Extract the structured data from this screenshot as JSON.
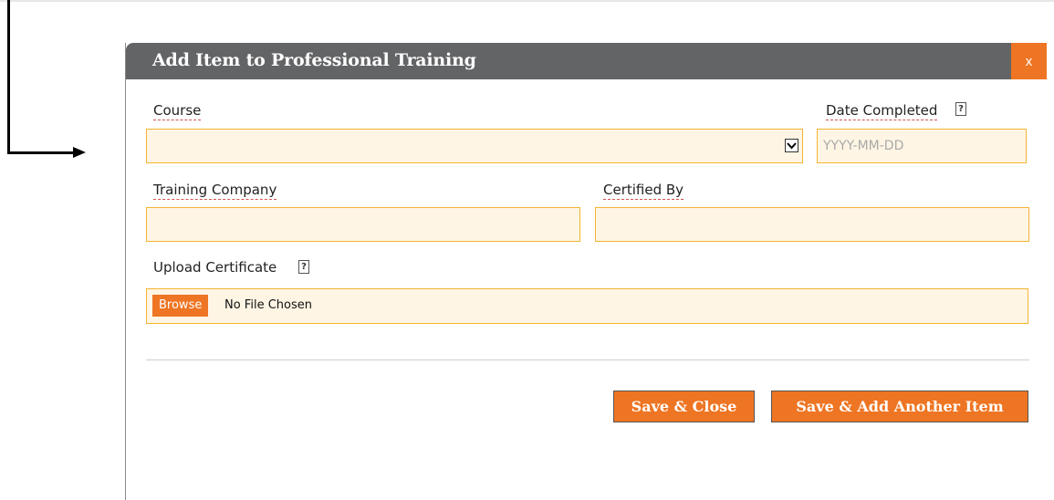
{
  "dialog": {
    "title": "Add Item to Professional Training",
    "close_label": "x"
  },
  "fields": {
    "course": {
      "label": "Course",
      "value": ""
    },
    "date_completed": {
      "label": "Date Completed",
      "placeholder": "YYYY-MM-DD",
      "value": ""
    },
    "training_company": {
      "label": "Training Company",
      "value": ""
    },
    "certified_by": {
      "label": "Certified By",
      "value": ""
    },
    "upload_certificate": {
      "label": "Upload Certificate",
      "browse_label": "Browse",
      "file_status": "No File Chosen"
    }
  },
  "help_glyph": "?",
  "actions": {
    "save_close": "Save & Close",
    "save_add_another": "Save & Add Another Item"
  },
  "colors": {
    "accent": "#ee7523",
    "header": "#636466",
    "field_bg": "#fff5e4",
    "field_border": "#f3b433"
  },
  "icons": {
    "select": "chevron-down-icon",
    "help": "help-icon",
    "pointer": "arrow-right-icon"
  }
}
